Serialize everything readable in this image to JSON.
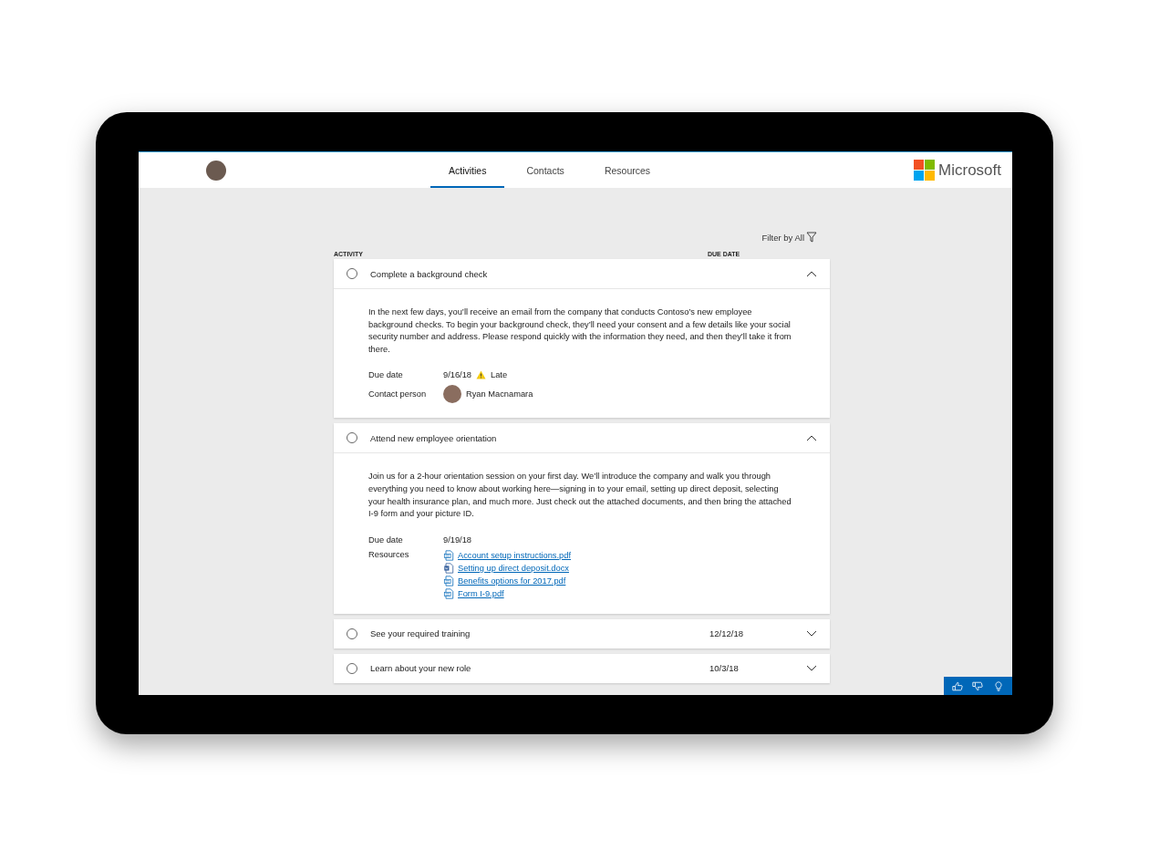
{
  "header": {
    "tabs": [
      {
        "label": "Activities",
        "selected": true
      },
      {
        "label": "Contacts",
        "selected": false
      },
      {
        "label": "Resources",
        "selected": false
      }
    ],
    "brand": "Microsoft"
  },
  "filter": {
    "label": "Filter by All"
  },
  "columns": [
    "ACTIVITY",
    "DUE DATE"
  ],
  "activities": [
    {
      "title": "Complete a background check",
      "checked": false,
      "expanded": true,
      "description": "In the next few days, you’ll receive an email from the company that conducts Contoso’s new employee background checks. To begin your background check, they’ll need your consent and a few details like your social security number and address. Please respond quickly with the information they need, and then they’ll take it from there.",
      "due_label": "Due date",
      "due_date": "9/16/18",
      "late": true,
      "late_label": "Late",
      "contact_label": "Contact person",
      "contact_name": "Ryan Macnamara"
    },
    {
      "title": "Attend new employee orientation",
      "checked": false,
      "expanded": true,
      "description": "Join us for a 2-hour orientation session on your first day. We’ll introduce the company and walk you through everything you need to know about working here—signing in to your email, setting up direct deposit, selecting your health insurance plan, and much more. Just check out the attached documents, and then bring the attached I-9 form and your picture ID.",
      "due_label": "Due date",
      "due_date": "9/19/18",
      "late": false,
      "resources_label": "Resources",
      "resources": [
        {
          "name": "Account setup instructions.pdf",
          "kind": "pdf"
        },
        {
          "name": "Setting up direct deposit.docx",
          "kind": "docx"
        },
        {
          "name": "Benefits options for 2017.pdf",
          "kind": "pdf"
        },
        {
          "name": "Form I-9.pdf",
          "kind": "pdf"
        }
      ]
    },
    {
      "title": "See your required training",
      "checked": false,
      "expanded": false,
      "due_date": "12/12/18"
    },
    {
      "title": "Learn about your new role",
      "checked": false,
      "expanded": false,
      "due_date": "10/3/18"
    }
  ]
}
